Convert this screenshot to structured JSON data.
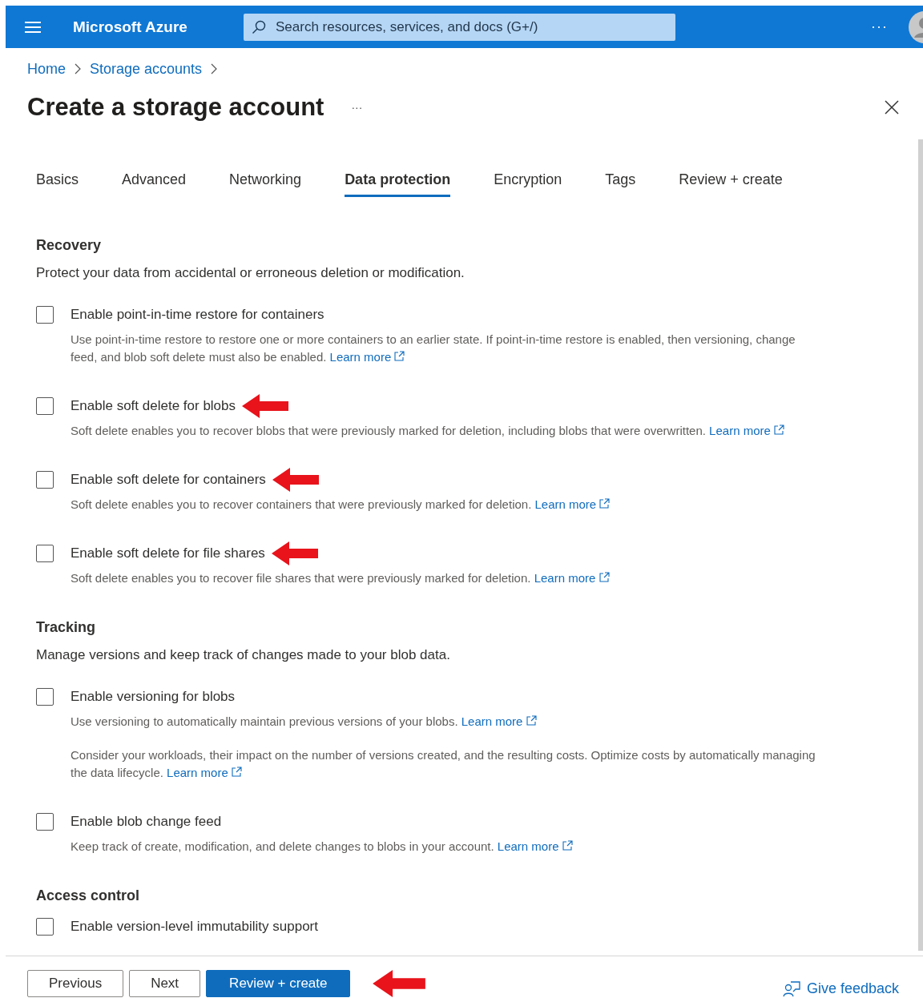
{
  "topbar": {
    "brand": "Microsoft Azure",
    "search": {
      "placeholder": "Search resources, services, and docs (G+/)"
    },
    "more": "···"
  },
  "breadcrumb": [
    "Home",
    "Storage accounts"
  ],
  "page": {
    "title": "Create a storage account",
    "more": "···"
  },
  "tabs": [
    {
      "label": "Basics",
      "selected": false
    },
    {
      "label": "Advanced",
      "selected": false
    },
    {
      "label": "Networking",
      "selected": false
    },
    {
      "label": "Data protection",
      "selected": true
    },
    {
      "label": "Encryption",
      "selected": false
    },
    {
      "label": "Tags",
      "selected": false
    },
    {
      "label": "Review + create",
      "selected": false
    }
  ],
  "sections": [
    {
      "title": "Recovery",
      "description": "Protect your data from accidental or erroneous deletion or modification.",
      "options": [
        {
          "label": "Enable point-in-time restore for containers",
          "checked": false,
          "annotated": false,
          "paragraphs": [
            {
              "text": "Use point-in-time restore to restore one or more containers to an earlier state. If point-in-time restore is enabled, then versioning, change feed, and blob soft delete must also be enabled.",
              "link": "Learn more"
            }
          ]
        },
        {
          "label": "Enable soft delete for blobs",
          "checked": false,
          "annotated": true,
          "paragraphs": [
            {
              "text": "Soft delete enables you to recover blobs that were previously marked for deletion, including blobs that were overwritten.",
              "link": "Learn more"
            }
          ]
        },
        {
          "label": "Enable soft delete for containers",
          "checked": false,
          "annotated": true,
          "paragraphs": [
            {
              "text": "Soft delete enables you to recover containers that were previously marked for deletion.",
              "link": "Learn more"
            }
          ]
        },
        {
          "label": "Enable soft delete for file shares",
          "checked": false,
          "annotated": true,
          "paragraphs": [
            {
              "text": "Soft delete enables you to recover file shares that were previously marked for deletion.",
              "link": "Learn more"
            }
          ]
        }
      ]
    },
    {
      "title": "Tracking",
      "description": "Manage versions and keep track of changes made to your blob data.",
      "options": [
        {
          "label": "Enable versioning for blobs",
          "checked": false,
          "annotated": false,
          "paragraphs": [
            {
              "text": "Use versioning to automatically maintain previous versions of your blobs.",
              "link": "Learn more"
            },
            {
              "text": "Consider your workloads, their impact on the number of versions created, and the resulting costs. Optimize costs by automatically managing the data lifecycle.",
              "link": "Learn more"
            }
          ]
        },
        {
          "label": "Enable blob change feed",
          "checked": false,
          "annotated": false,
          "paragraphs": [
            {
              "text": "Keep track of create, modification, and delete changes to blobs in your account.",
              "link": "Learn more"
            }
          ]
        }
      ]
    },
    {
      "title": "Access control",
      "options": [
        {
          "label": "Enable version-level immutability support",
          "checked": false,
          "annotated": false
        }
      ]
    }
  ],
  "footer": {
    "buttons": [
      {
        "label": "Previous",
        "kind": "secondary"
      },
      {
        "label": "Next",
        "kind": "secondary"
      },
      {
        "label": "Review + create",
        "kind": "primary"
      }
    ],
    "annotated": true,
    "feedback": "Give feedback"
  }
}
